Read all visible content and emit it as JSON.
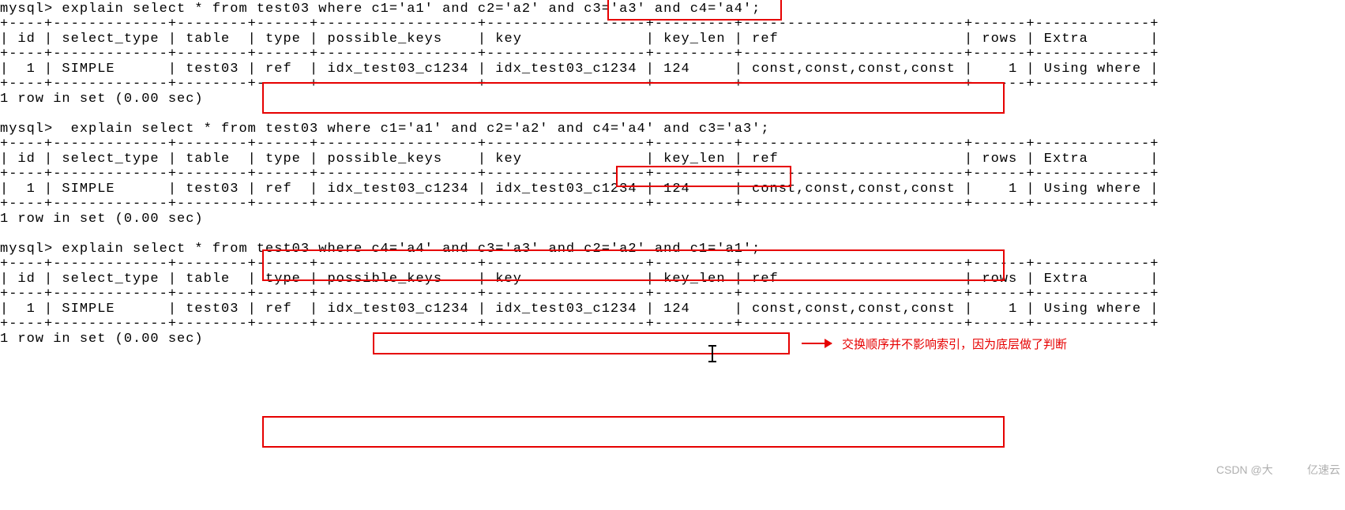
{
  "blocks": [
    {
      "prompt": "mysql> explain select * from test03 where c1='a1' and c2='a2' and c3='a3' and c4='a4';",
      "sep": "+----+-------------+--------+------+------------------+------------------+---------+-------------------------+------+-------------+",
      "header": "| id | select_type | table  | type | possible_keys    | key              | key_len | ref                     | rows | Extra       |",
      "row": "|  1 | SIMPLE      | test03 | ref  | idx_test03_c1234 | idx_test03_c1234 | 124     | const,const,const,const |    1 | Using where |",
      "footer": "1 row in set (0.00 sec)"
    },
    {
      "prompt": "mysql>  explain select * from test03 where c1='a1' and c2='a2' and c4='a4' and c3='a3';",
      "sep": "+----+-------------+--------+------+------------------+------------------+---------+-------------------------+------+-------------+",
      "header": "| id | select_type | table  | type | possible_keys    | key              | key_len | ref                     | rows | Extra       |",
      "row": "|  1 | SIMPLE      | test03 | ref  | idx_test03_c1234 | idx_test03_c1234 | 124     | const,const,const,const |    1 | Using where |",
      "footer": "1 row in set (0.00 sec)"
    },
    {
      "prompt": "mysql> explain select * from test03 where c4='a4' and c3='a3' and c2='a2' and c1='a1';",
      "sep": "+----+-------------+--------+------+------------------+------------------+---------+-------------------------+------+-------------+",
      "header": "| id | select_type | table  | type | possible_keys    | key              | key_len | ref                     | rows | Extra       |",
      "row": "|  1 | SIMPLE      | test03 | ref  | idx_test03_c1234 | idx_test03_c1234 | 124     | const,const,const,const |    1 | Using where |",
      "footer": "1 row in set (0.00 sec)"
    }
  ],
  "annotation": "交换顺序并不影响索引，因为底层做了判断",
  "watermark1": "CSDN @大",
  "watermark2": "亿速云"
}
